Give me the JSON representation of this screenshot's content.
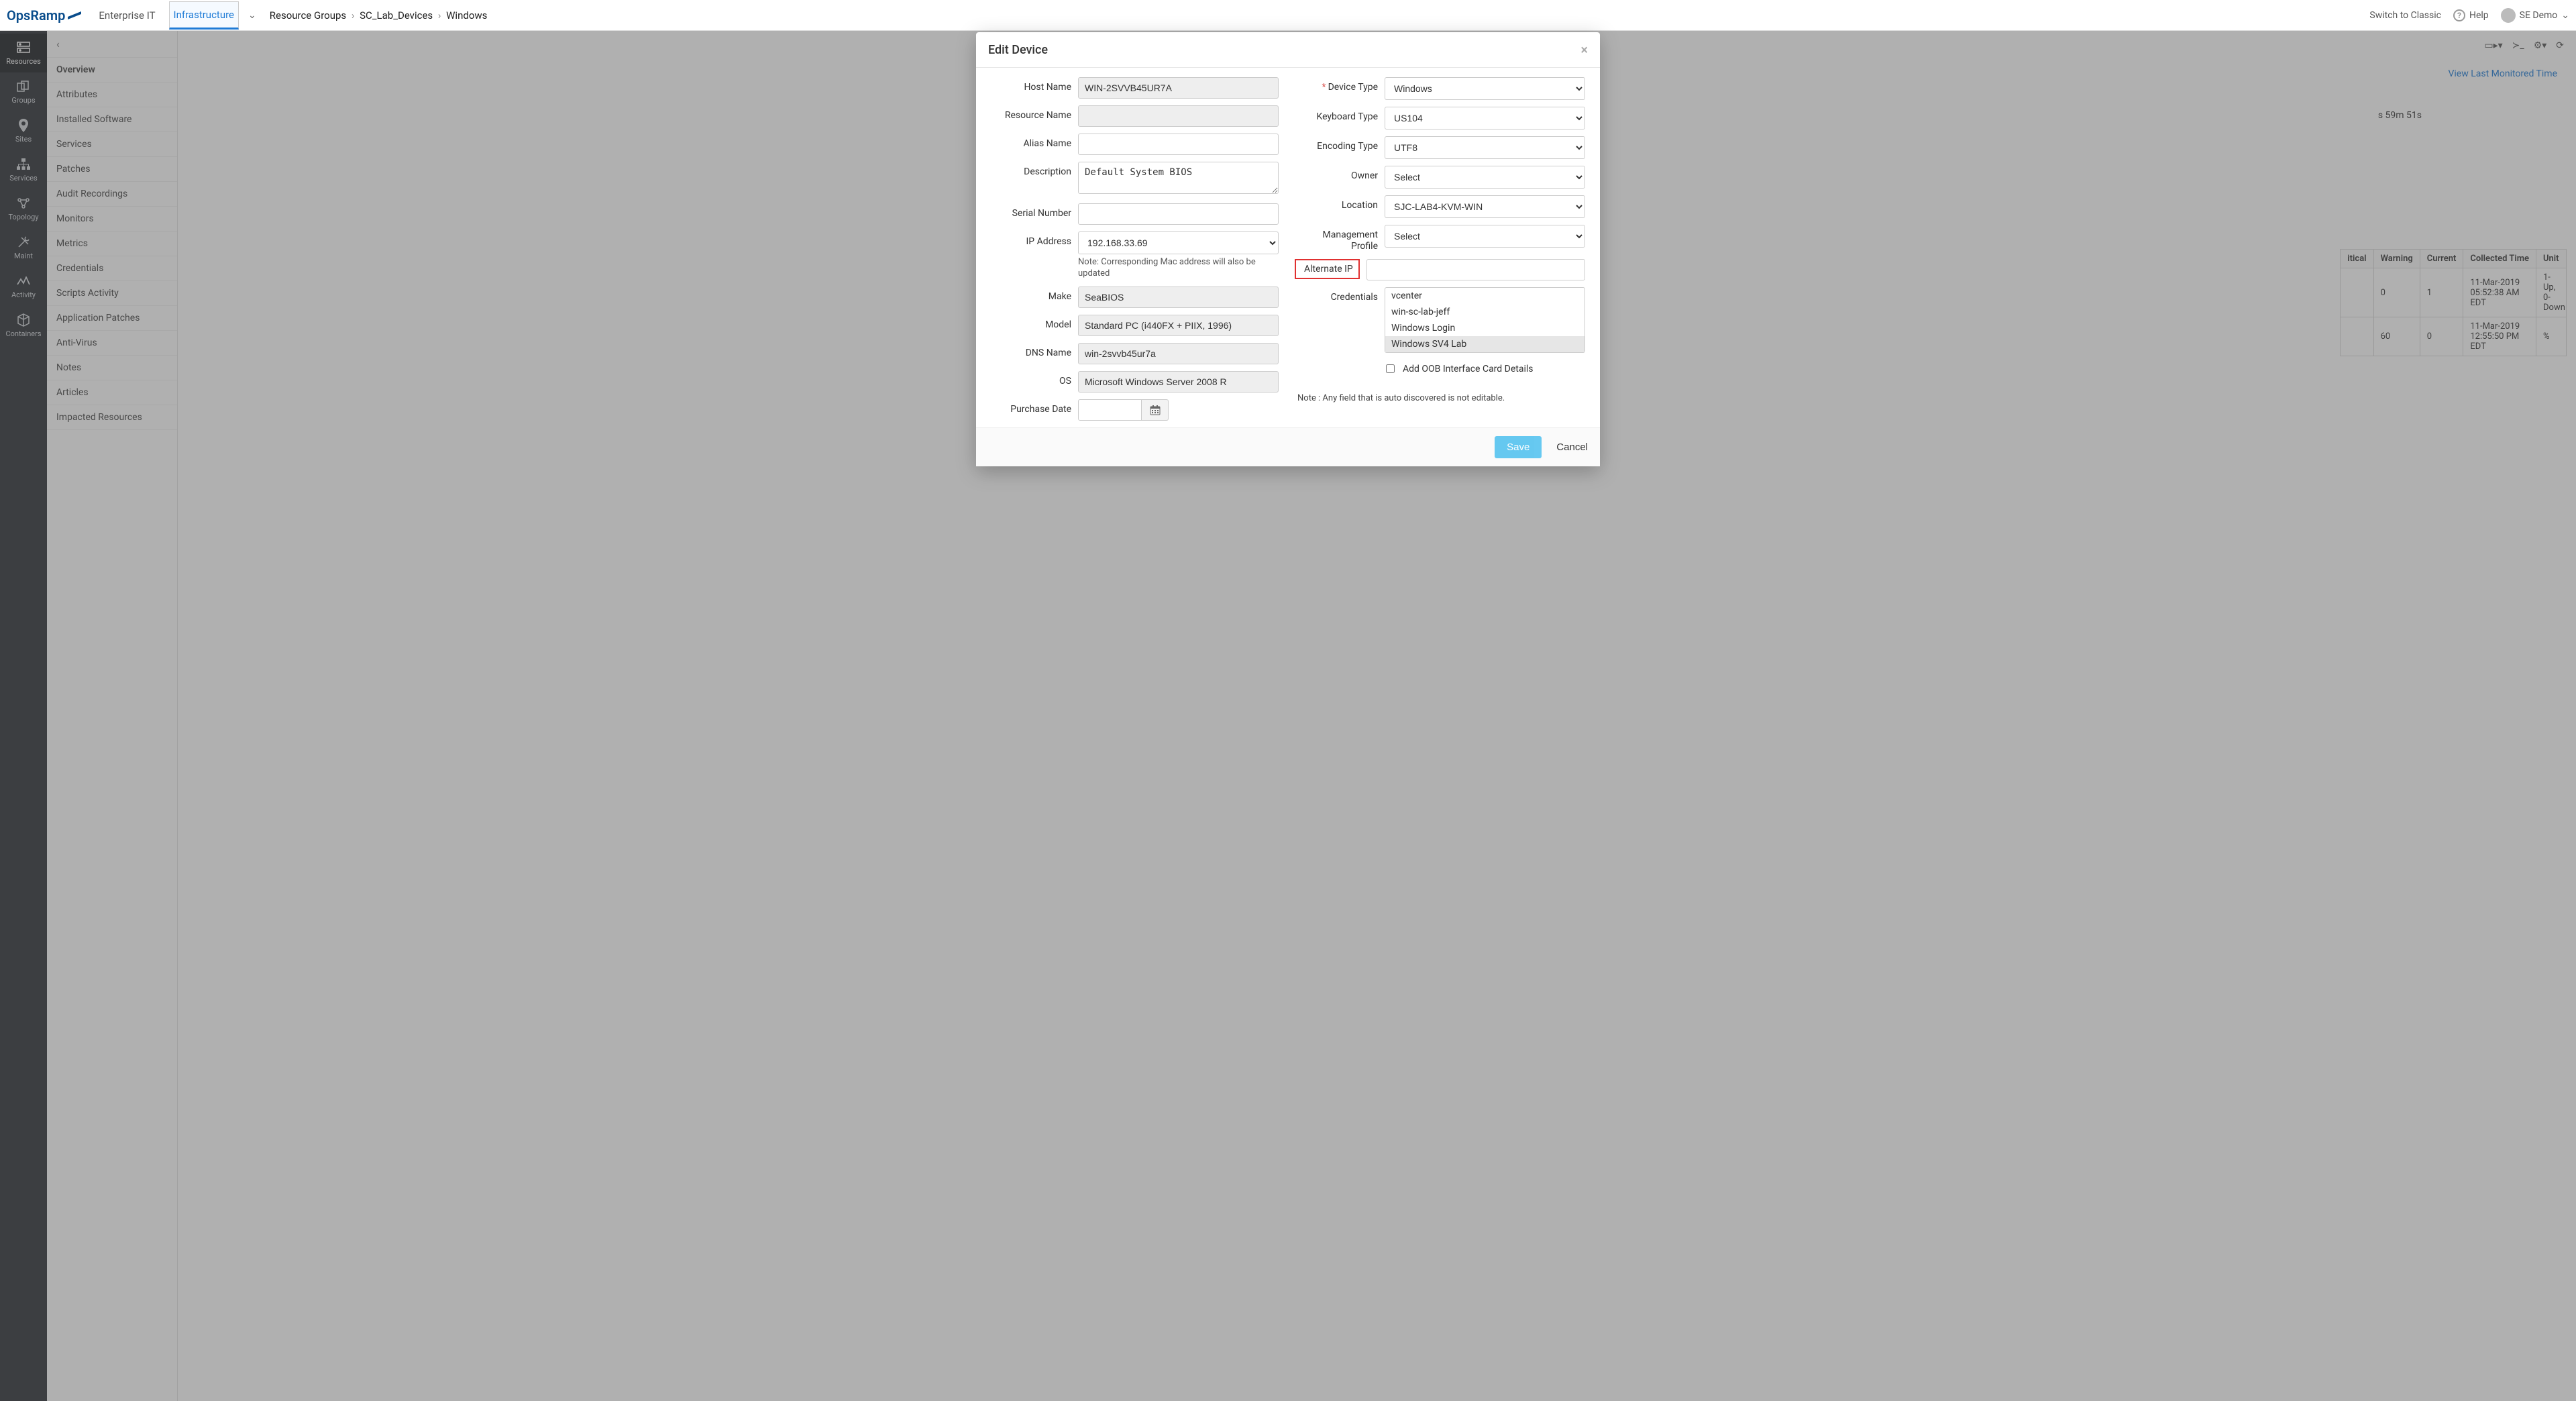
{
  "brand": "OpsRamp",
  "top_tabs": {
    "enterprise": "Enterprise IT",
    "infrastructure": "Infrastructure"
  },
  "breadcrumb": {
    "a": "Resource Groups",
    "b": "SC_Lab_Devices",
    "c": "Windows",
    "sep": "›"
  },
  "top_right": {
    "switch": "Switch to Classic",
    "help": "Help",
    "user": "SE Demo"
  },
  "rail": {
    "resources": "Resources",
    "groups": "Groups",
    "sites": "Sites",
    "services": "Services",
    "topology": "Topology",
    "maint": "Maint",
    "activity": "Activity",
    "containers": "Containers"
  },
  "sidenav": {
    "overview": "Overview",
    "attributes": "Attributes",
    "installed_software": "Installed Software",
    "services": "Services",
    "patches": "Patches",
    "audit_recordings": "Audit Recordings",
    "monitors": "Monitors",
    "metrics": "Metrics",
    "credentials": "Credentials",
    "scripts_activity": "Scripts Activity",
    "application_patches": "Application Patches",
    "anti_virus": "Anti-Virus",
    "notes": "Notes",
    "articles": "Articles",
    "impacted_resources": "Impacted Resources"
  },
  "bg": {
    "view_monitored": "View Last Monitored Time",
    "uptime_frag": "s 59m 51s",
    "table": {
      "headers": {
        "itical": "itical",
        "warning": "Warning",
        "current": "Current",
        "collected": "Collected Time",
        "unit": "Unit"
      },
      "rows": [
        {
          "itical": "",
          "warning": "0",
          "current": "1",
          "collected": "11-Mar-2019 05:52:38 AM EDT",
          "unit": "1-Up, 0-Down"
        },
        {
          "itical": "",
          "warning": "60",
          "current": "0",
          "collected": "11-Mar-2019 12:55:50 PM EDT",
          "unit": "%"
        }
      ]
    }
  },
  "modal": {
    "title": "Edit Device",
    "left": {
      "host_name": {
        "label": "Host Name",
        "value": "WIN-2SVVB45UR7A"
      },
      "resource_name": {
        "label": "Resource Name",
        "value": ""
      },
      "alias_name": {
        "label": "Alias Name",
        "value": ""
      },
      "description": {
        "label": "Description",
        "value": "Default System BIOS"
      },
      "serial_number": {
        "label": "Serial Number",
        "value": ""
      },
      "ip_address": {
        "label": "IP Address",
        "value": "192.168.33.69",
        "note": "Note: Corresponding Mac address will also be updated"
      },
      "make": {
        "label": "Make",
        "value": "SeaBIOS"
      },
      "model": {
        "label": "Model",
        "value": "Standard PC (i440FX + PIIX, 1996)"
      },
      "dns_name": {
        "label": "DNS Name",
        "value": "win-2svvb45ur7a"
      },
      "os": {
        "label": "OS",
        "value": "Microsoft Windows Server 2008 R"
      },
      "purchase_date": {
        "label": "Purchase Date",
        "value": ""
      }
    },
    "right": {
      "device_type": {
        "label": "Device Type",
        "value": "Windows"
      },
      "keyboard_type": {
        "label": "Keyboard Type",
        "value": "US104"
      },
      "encoding_type": {
        "label": "Encoding Type",
        "value": "UTF8"
      },
      "owner": {
        "label": "Owner",
        "value": "Select"
      },
      "location": {
        "label": "Location",
        "value": "SJC-LAB4-KVM-WIN"
      },
      "management_profile": {
        "label": "Management Profile",
        "value": "Select"
      },
      "alternate_ip": {
        "label": "Alternate IP",
        "value": ""
      },
      "credentials": {
        "label": "Credentials",
        "items": [
          "vcenter",
          "win-sc-lab-jeff",
          "Windows Login",
          "Windows SV4 Lab"
        ]
      },
      "oob": "Add OOB Interface Card Details",
      "footnote": "Note : Any field that is auto discovered is not editable."
    },
    "footer": {
      "save": "Save",
      "cancel": "Cancel"
    }
  }
}
